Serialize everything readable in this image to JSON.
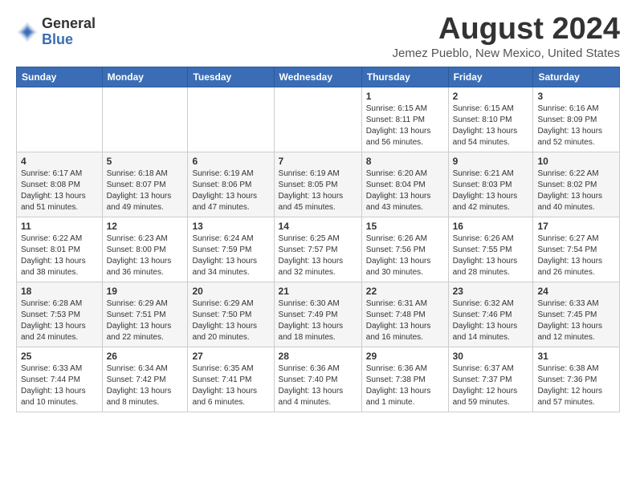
{
  "logo": {
    "general": "General",
    "blue": "Blue"
  },
  "header": {
    "month": "August 2024",
    "location": "Jemez Pueblo, New Mexico, United States"
  },
  "weekdays": [
    "Sunday",
    "Monday",
    "Tuesday",
    "Wednesday",
    "Thursday",
    "Friday",
    "Saturday"
  ],
  "weeks": [
    [
      {
        "day": "",
        "info": ""
      },
      {
        "day": "",
        "info": ""
      },
      {
        "day": "",
        "info": ""
      },
      {
        "day": "",
        "info": ""
      },
      {
        "day": "1",
        "info": "Sunrise: 6:15 AM\nSunset: 8:11 PM\nDaylight: 13 hours\nand 56 minutes."
      },
      {
        "day": "2",
        "info": "Sunrise: 6:15 AM\nSunset: 8:10 PM\nDaylight: 13 hours\nand 54 minutes."
      },
      {
        "day": "3",
        "info": "Sunrise: 6:16 AM\nSunset: 8:09 PM\nDaylight: 13 hours\nand 52 minutes."
      }
    ],
    [
      {
        "day": "4",
        "info": "Sunrise: 6:17 AM\nSunset: 8:08 PM\nDaylight: 13 hours\nand 51 minutes."
      },
      {
        "day": "5",
        "info": "Sunrise: 6:18 AM\nSunset: 8:07 PM\nDaylight: 13 hours\nand 49 minutes."
      },
      {
        "day": "6",
        "info": "Sunrise: 6:19 AM\nSunset: 8:06 PM\nDaylight: 13 hours\nand 47 minutes."
      },
      {
        "day": "7",
        "info": "Sunrise: 6:19 AM\nSunset: 8:05 PM\nDaylight: 13 hours\nand 45 minutes."
      },
      {
        "day": "8",
        "info": "Sunrise: 6:20 AM\nSunset: 8:04 PM\nDaylight: 13 hours\nand 43 minutes."
      },
      {
        "day": "9",
        "info": "Sunrise: 6:21 AM\nSunset: 8:03 PM\nDaylight: 13 hours\nand 42 minutes."
      },
      {
        "day": "10",
        "info": "Sunrise: 6:22 AM\nSunset: 8:02 PM\nDaylight: 13 hours\nand 40 minutes."
      }
    ],
    [
      {
        "day": "11",
        "info": "Sunrise: 6:22 AM\nSunset: 8:01 PM\nDaylight: 13 hours\nand 38 minutes."
      },
      {
        "day": "12",
        "info": "Sunrise: 6:23 AM\nSunset: 8:00 PM\nDaylight: 13 hours\nand 36 minutes."
      },
      {
        "day": "13",
        "info": "Sunrise: 6:24 AM\nSunset: 7:59 PM\nDaylight: 13 hours\nand 34 minutes."
      },
      {
        "day": "14",
        "info": "Sunrise: 6:25 AM\nSunset: 7:57 PM\nDaylight: 13 hours\nand 32 minutes."
      },
      {
        "day": "15",
        "info": "Sunrise: 6:26 AM\nSunset: 7:56 PM\nDaylight: 13 hours\nand 30 minutes."
      },
      {
        "day": "16",
        "info": "Sunrise: 6:26 AM\nSunset: 7:55 PM\nDaylight: 13 hours\nand 28 minutes."
      },
      {
        "day": "17",
        "info": "Sunrise: 6:27 AM\nSunset: 7:54 PM\nDaylight: 13 hours\nand 26 minutes."
      }
    ],
    [
      {
        "day": "18",
        "info": "Sunrise: 6:28 AM\nSunset: 7:53 PM\nDaylight: 13 hours\nand 24 minutes."
      },
      {
        "day": "19",
        "info": "Sunrise: 6:29 AM\nSunset: 7:51 PM\nDaylight: 13 hours\nand 22 minutes."
      },
      {
        "day": "20",
        "info": "Sunrise: 6:29 AM\nSunset: 7:50 PM\nDaylight: 13 hours\nand 20 minutes."
      },
      {
        "day": "21",
        "info": "Sunrise: 6:30 AM\nSunset: 7:49 PM\nDaylight: 13 hours\nand 18 minutes."
      },
      {
        "day": "22",
        "info": "Sunrise: 6:31 AM\nSunset: 7:48 PM\nDaylight: 13 hours\nand 16 minutes."
      },
      {
        "day": "23",
        "info": "Sunrise: 6:32 AM\nSunset: 7:46 PM\nDaylight: 13 hours\nand 14 minutes."
      },
      {
        "day": "24",
        "info": "Sunrise: 6:33 AM\nSunset: 7:45 PM\nDaylight: 13 hours\nand 12 minutes."
      }
    ],
    [
      {
        "day": "25",
        "info": "Sunrise: 6:33 AM\nSunset: 7:44 PM\nDaylight: 13 hours\nand 10 minutes."
      },
      {
        "day": "26",
        "info": "Sunrise: 6:34 AM\nSunset: 7:42 PM\nDaylight: 13 hours\nand 8 minutes."
      },
      {
        "day": "27",
        "info": "Sunrise: 6:35 AM\nSunset: 7:41 PM\nDaylight: 13 hours\nand 6 minutes."
      },
      {
        "day": "28",
        "info": "Sunrise: 6:36 AM\nSunset: 7:40 PM\nDaylight: 13 hours\nand 4 minutes."
      },
      {
        "day": "29",
        "info": "Sunrise: 6:36 AM\nSunset: 7:38 PM\nDaylight: 13 hours\nand 1 minute."
      },
      {
        "day": "30",
        "info": "Sunrise: 6:37 AM\nSunset: 7:37 PM\nDaylight: 12 hours\nand 59 minutes."
      },
      {
        "day": "31",
        "info": "Sunrise: 6:38 AM\nSunset: 7:36 PM\nDaylight: 12 hours\nand 57 minutes."
      }
    ]
  ]
}
